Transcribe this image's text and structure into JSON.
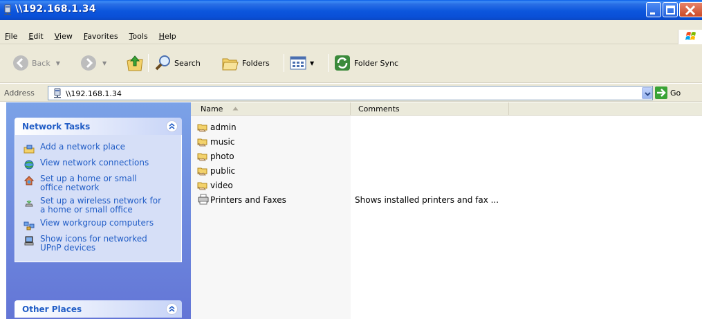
{
  "window": {
    "title": "\\\\192.168.1.34"
  },
  "menu": {
    "items": [
      "File",
      "Edit",
      "View",
      "Favorites",
      "Tools",
      "Help"
    ]
  },
  "toolbar": {
    "back_label": "Back",
    "search_label": "Search",
    "folders_label": "Folders",
    "folder_sync_label": "Folder Sync"
  },
  "address": {
    "label": "Address",
    "value": "\\\\192.168.1.34",
    "go_label": "Go"
  },
  "sidebar": {
    "network_tasks": {
      "title": "Network Tasks",
      "items": [
        {
          "label": "Add a network place",
          "icon": "add-network-place-icon"
        },
        {
          "label": "View network connections",
          "icon": "network-connections-icon"
        },
        {
          "label": "Set up a home or small office network",
          "icon": "home-network-icon"
        },
        {
          "label": "Set up a wireless network for a home or small office",
          "icon": "wireless-network-icon"
        },
        {
          "label": "View workgroup computers",
          "icon": "workgroup-computers-icon"
        },
        {
          "label": "Show icons for networked UPnP devices",
          "icon": "upnp-devices-icon"
        }
      ]
    },
    "other_places": {
      "title": "Other Places"
    }
  },
  "list": {
    "columns": [
      "Name",
      "Comments"
    ],
    "rows": [
      {
        "name": "admin",
        "comment": "",
        "icon": "shared-folder-icon"
      },
      {
        "name": "music",
        "comment": "",
        "icon": "shared-folder-icon"
      },
      {
        "name": "photo",
        "comment": "",
        "icon": "shared-folder-icon"
      },
      {
        "name": "public",
        "comment": "",
        "icon": "shared-folder-icon"
      },
      {
        "name": "video",
        "comment": "",
        "icon": "shared-folder-icon"
      },
      {
        "name": "Printers and Faxes",
        "comment": "Shows installed printers and fax ...",
        "icon": "printers-faxes-icon"
      }
    ]
  },
  "colors": {
    "title_bar": "#0a4fd6",
    "task_link": "#215dc6",
    "panel_bg": "#d6dff7",
    "sidebar_bg": "#7ba2e7"
  }
}
